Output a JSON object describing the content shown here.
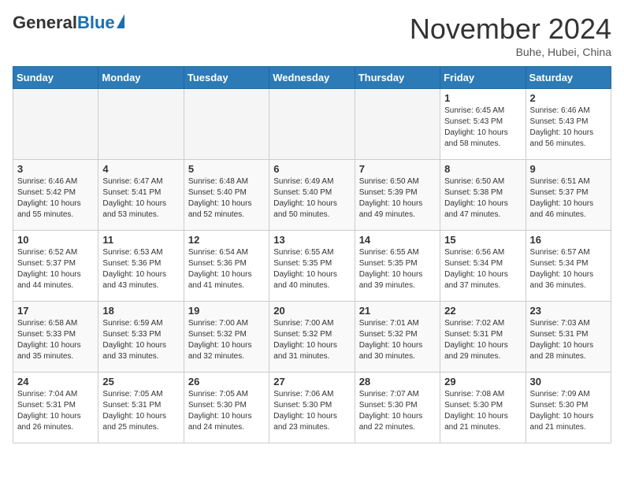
{
  "header": {
    "logo_general": "General",
    "logo_blue": "Blue",
    "month": "November 2024",
    "location": "Buhe, Hubei, China"
  },
  "days_of_week": [
    "Sunday",
    "Monday",
    "Tuesday",
    "Wednesday",
    "Thursday",
    "Friday",
    "Saturday"
  ],
  "weeks": [
    [
      {
        "day": "",
        "empty": true
      },
      {
        "day": "",
        "empty": true
      },
      {
        "day": "",
        "empty": true
      },
      {
        "day": "",
        "empty": true
      },
      {
        "day": "",
        "empty": true
      },
      {
        "day": "1",
        "sunrise": "Sunrise: 6:45 AM",
        "sunset": "Sunset: 5:43 PM",
        "daylight": "Daylight: 10 hours and 58 minutes."
      },
      {
        "day": "2",
        "sunrise": "Sunrise: 6:46 AM",
        "sunset": "Sunset: 5:43 PM",
        "daylight": "Daylight: 10 hours and 56 minutes."
      }
    ],
    [
      {
        "day": "3",
        "sunrise": "Sunrise: 6:46 AM",
        "sunset": "Sunset: 5:42 PM",
        "daylight": "Daylight: 10 hours and 55 minutes."
      },
      {
        "day": "4",
        "sunrise": "Sunrise: 6:47 AM",
        "sunset": "Sunset: 5:41 PM",
        "daylight": "Daylight: 10 hours and 53 minutes."
      },
      {
        "day": "5",
        "sunrise": "Sunrise: 6:48 AM",
        "sunset": "Sunset: 5:40 PM",
        "daylight": "Daylight: 10 hours and 52 minutes."
      },
      {
        "day": "6",
        "sunrise": "Sunrise: 6:49 AM",
        "sunset": "Sunset: 5:40 PM",
        "daylight": "Daylight: 10 hours and 50 minutes."
      },
      {
        "day": "7",
        "sunrise": "Sunrise: 6:50 AM",
        "sunset": "Sunset: 5:39 PM",
        "daylight": "Daylight: 10 hours and 49 minutes."
      },
      {
        "day": "8",
        "sunrise": "Sunrise: 6:50 AM",
        "sunset": "Sunset: 5:38 PM",
        "daylight": "Daylight: 10 hours and 47 minutes."
      },
      {
        "day": "9",
        "sunrise": "Sunrise: 6:51 AM",
        "sunset": "Sunset: 5:37 PM",
        "daylight": "Daylight: 10 hours and 46 minutes."
      }
    ],
    [
      {
        "day": "10",
        "sunrise": "Sunrise: 6:52 AM",
        "sunset": "Sunset: 5:37 PM",
        "daylight": "Daylight: 10 hours and 44 minutes."
      },
      {
        "day": "11",
        "sunrise": "Sunrise: 6:53 AM",
        "sunset": "Sunset: 5:36 PM",
        "daylight": "Daylight: 10 hours and 43 minutes."
      },
      {
        "day": "12",
        "sunrise": "Sunrise: 6:54 AM",
        "sunset": "Sunset: 5:36 PM",
        "daylight": "Daylight: 10 hours and 41 minutes."
      },
      {
        "day": "13",
        "sunrise": "Sunrise: 6:55 AM",
        "sunset": "Sunset: 5:35 PM",
        "daylight": "Daylight: 10 hours and 40 minutes."
      },
      {
        "day": "14",
        "sunrise": "Sunrise: 6:55 AM",
        "sunset": "Sunset: 5:35 PM",
        "daylight": "Daylight: 10 hours and 39 minutes."
      },
      {
        "day": "15",
        "sunrise": "Sunrise: 6:56 AM",
        "sunset": "Sunset: 5:34 PM",
        "daylight": "Daylight: 10 hours and 37 minutes."
      },
      {
        "day": "16",
        "sunrise": "Sunrise: 6:57 AM",
        "sunset": "Sunset: 5:34 PM",
        "daylight": "Daylight: 10 hours and 36 minutes."
      }
    ],
    [
      {
        "day": "17",
        "sunrise": "Sunrise: 6:58 AM",
        "sunset": "Sunset: 5:33 PM",
        "daylight": "Daylight: 10 hours and 35 minutes."
      },
      {
        "day": "18",
        "sunrise": "Sunrise: 6:59 AM",
        "sunset": "Sunset: 5:33 PM",
        "daylight": "Daylight: 10 hours and 33 minutes."
      },
      {
        "day": "19",
        "sunrise": "Sunrise: 7:00 AM",
        "sunset": "Sunset: 5:32 PM",
        "daylight": "Daylight: 10 hours and 32 minutes."
      },
      {
        "day": "20",
        "sunrise": "Sunrise: 7:00 AM",
        "sunset": "Sunset: 5:32 PM",
        "daylight": "Daylight: 10 hours and 31 minutes."
      },
      {
        "day": "21",
        "sunrise": "Sunrise: 7:01 AM",
        "sunset": "Sunset: 5:32 PM",
        "daylight": "Daylight: 10 hours and 30 minutes."
      },
      {
        "day": "22",
        "sunrise": "Sunrise: 7:02 AM",
        "sunset": "Sunset: 5:31 PM",
        "daylight": "Daylight: 10 hours and 29 minutes."
      },
      {
        "day": "23",
        "sunrise": "Sunrise: 7:03 AM",
        "sunset": "Sunset: 5:31 PM",
        "daylight": "Daylight: 10 hours and 28 minutes."
      }
    ],
    [
      {
        "day": "24",
        "sunrise": "Sunrise: 7:04 AM",
        "sunset": "Sunset: 5:31 PM",
        "daylight": "Daylight: 10 hours and 26 minutes."
      },
      {
        "day": "25",
        "sunrise": "Sunrise: 7:05 AM",
        "sunset": "Sunset: 5:31 PM",
        "daylight": "Daylight: 10 hours and 25 minutes."
      },
      {
        "day": "26",
        "sunrise": "Sunrise: 7:05 AM",
        "sunset": "Sunset: 5:30 PM",
        "daylight": "Daylight: 10 hours and 24 minutes."
      },
      {
        "day": "27",
        "sunrise": "Sunrise: 7:06 AM",
        "sunset": "Sunset: 5:30 PM",
        "daylight": "Daylight: 10 hours and 23 minutes."
      },
      {
        "day": "28",
        "sunrise": "Sunrise: 7:07 AM",
        "sunset": "Sunset: 5:30 PM",
        "daylight": "Daylight: 10 hours and 22 minutes."
      },
      {
        "day": "29",
        "sunrise": "Sunrise: 7:08 AM",
        "sunset": "Sunset: 5:30 PM",
        "daylight": "Daylight: 10 hours and 21 minutes."
      },
      {
        "day": "30",
        "sunrise": "Sunrise: 7:09 AM",
        "sunset": "Sunset: 5:30 PM",
        "daylight": "Daylight: 10 hours and 21 minutes."
      }
    ]
  ]
}
